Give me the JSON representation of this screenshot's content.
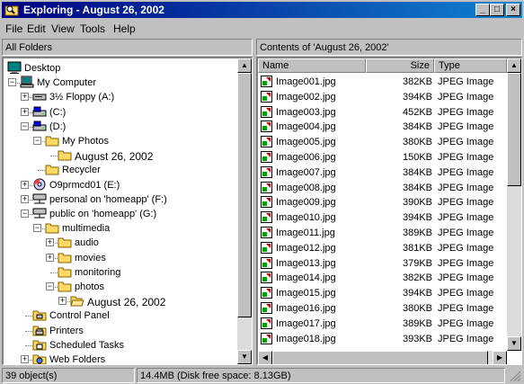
{
  "window": {
    "title": "Exploring - August 26, 2002",
    "controls": {
      "minimize": "_",
      "maximize": "□",
      "close": "×"
    }
  },
  "menu": [
    "File",
    "Edit",
    "View",
    "Tools",
    "Help"
  ],
  "left_pane": {
    "header": "All Folders",
    "tree": [
      {
        "label": "Desktop",
        "icon": "desktop-icon"
      },
      {
        "label": "My Computer",
        "icon": "computer-icon"
      },
      {
        "label": "3½ Floppy (A:)",
        "icon": "floppy-icon"
      },
      {
        "label": "(C:)",
        "icon": "drive-icon"
      },
      {
        "label": "(D:)",
        "icon": "drive-icon"
      },
      {
        "label": "My Photos",
        "icon": "folder-icon"
      },
      {
        "label": "August 26, 2002",
        "icon": "folder-icon"
      },
      {
        "label": "Recycler",
        "icon": "folder-icon"
      },
      {
        "label": "O9prmcd01 (E:)",
        "icon": "cd-icon"
      },
      {
        "label": "personal on 'homeapp' (F:)",
        "icon": "network-drive-icon"
      },
      {
        "label": "public on 'homeapp' (G:)",
        "icon": "network-drive-icon"
      },
      {
        "label": "multimedia",
        "icon": "folder-icon"
      },
      {
        "label": "audio",
        "icon": "folder-icon"
      },
      {
        "label": "movies",
        "icon": "folder-icon"
      },
      {
        "label": "monitoring",
        "icon": "folder-icon"
      },
      {
        "label": "photos",
        "icon": "folder-icon"
      },
      {
        "label": "August 26, 2002",
        "icon": "folder-open-icon"
      },
      {
        "label": "Control Panel",
        "icon": "control-panel-icon"
      },
      {
        "label": "Printers",
        "icon": "printers-icon"
      },
      {
        "label": "Scheduled Tasks",
        "icon": "scheduled-tasks-icon"
      },
      {
        "label": "Web Folders",
        "icon": "web-folders-icon"
      }
    ]
  },
  "right_pane": {
    "header": "Contents of 'August 26, 2002'",
    "columns": {
      "name": "Name",
      "size": "Size",
      "type": "Type"
    },
    "files": [
      {
        "name": "Image001.jpg",
        "size": "382KB",
        "type": "JPEG Image"
      },
      {
        "name": "Image002.jpg",
        "size": "394KB",
        "type": "JPEG Image"
      },
      {
        "name": "Image003.jpg",
        "size": "452KB",
        "type": "JPEG Image"
      },
      {
        "name": "Image004.jpg",
        "size": "384KB",
        "type": "JPEG Image"
      },
      {
        "name": "Image005.jpg",
        "size": "380KB",
        "type": "JPEG Image"
      },
      {
        "name": "Image006.jpg",
        "size": "150KB",
        "type": "JPEG Image"
      },
      {
        "name": "Image007.jpg",
        "size": "384KB",
        "type": "JPEG Image"
      },
      {
        "name": "Image008.jpg",
        "size": "384KB",
        "type": "JPEG Image"
      },
      {
        "name": "Image009.jpg",
        "size": "390KB",
        "type": "JPEG Image"
      },
      {
        "name": "Image010.jpg",
        "size": "394KB",
        "type": "JPEG Image"
      },
      {
        "name": "Image011.jpg",
        "size": "389KB",
        "type": "JPEG Image"
      },
      {
        "name": "Image012.jpg",
        "size": "381KB",
        "type": "JPEG Image"
      },
      {
        "name": "Image013.jpg",
        "size": "379KB",
        "type": "JPEG Image"
      },
      {
        "name": "Image014.jpg",
        "size": "382KB",
        "type": "JPEG Image"
      },
      {
        "name": "Image015.jpg",
        "size": "394KB",
        "type": "JPEG Image"
      },
      {
        "name": "Image016.jpg",
        "size": "380KB",
        "type": "JPEG Image"
      },
      {
        "name": "Image017.jpg",
        "size": "389KB",
        "type": "JPEG Image"
      },
      {
        "name": "Image018.jpg",
        "size": "393KB",
        "type": "JPEG Image"
      }
    ]
  },
  "status": {
    "objects": "39 object(s)",
    "disk": "14.4MB (Disk free space: 8.13GB)"
  },
  "colors": {
    "title_start": "#000080",
    "title_end": "#1084d0",
    "face": "#c0c0c0",
    "folder": "#ffd966"
  }
}
